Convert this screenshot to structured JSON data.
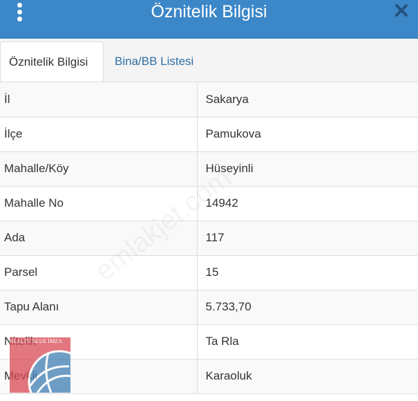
{
  "header": {
    "title": "Öznitelik Bilgisi",
    "menu_icon": "vertical-dots-icon",
    "close_icon": "close-icon",
    "accent_color": "#3c87c8"
  },
  "tabs": [
    {
      "label": "Öznitelik Bilgisi",
      "active": true
    },
    {
      "label": "Bina/BB Listesi",
      "active": false
    }
  ],
  "attributes": [
    {
      "key": "İl",
      "value": "Sakarya"
    },
    {
      "key": "İlçe",
      "value": "Pamukova"
    },
    {
      "key": "Mahalle/Köy",
      "value": "Hüseyinli"
    },
    {
      "key": "Mahalle No",
      "value": "14942"
    },
    {
      "key": "Ada",
      "value": "117"
    },
    {
      "key": "Parsel",
      "value": "15"
    },
    {
      "key": "Tapu Alanı",
      "value": "5.733,70"
    },
    {
      "key": "Nitelik",
      "value": "Ta Rla"
    },
    {
      "key": "Mevkii",
      "value": "Karaoluk"
    }
  ],
  "watermark": "emlakjet.com",
  "logo": {
    "text": "REALTY BLUE İMZA"
  }
}
